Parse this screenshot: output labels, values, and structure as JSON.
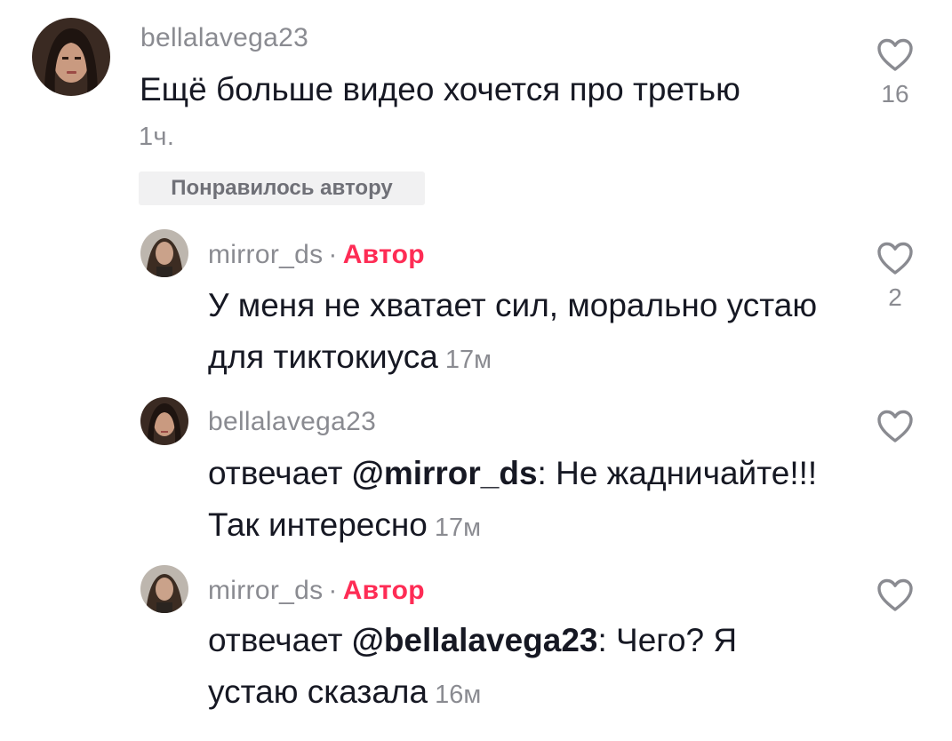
{
  "comment": {
    "username": "bellalavega23",
    "text": "Ещё больше видео хочется про третью",
    "time": "1ч.",
    "badge": "Понравилось автору",
    "likes": "16"
  },
  "replies": [
    {
      "username": "mirror_ds",
      "separator": "·",
      "author_label": "Автор",
      "text": "У меня не хватает сил, морально устаю для тиктокиуса",
      "time": "17м",
      "likes": "2"
    },
    {
      "username": "bellalavega23",
      "reply_prefix": "отвечает ",
      "mention": "@mirror_ds",
      "text_after": ": Не жадничайте!!! Так интересно",
      "time": "17м"
    },
    {
      "username": "mirror_ds",
      "separator": "·",
      "author_label": "Автор",
      "reply_prefix": "отвечает ",
      "mention": "@bellalavega23",
      "text_after": ": Чего? Я устаю сказала",
      "time": "16м"
    }
  ],
  "icons": {
    "like": "heart-outline-icon"
  },
  "colors": {
    "author": "#fe2c55",
    "secondary_text": "#8a8b91",
    "primary_text": "#161823"
  }
}
